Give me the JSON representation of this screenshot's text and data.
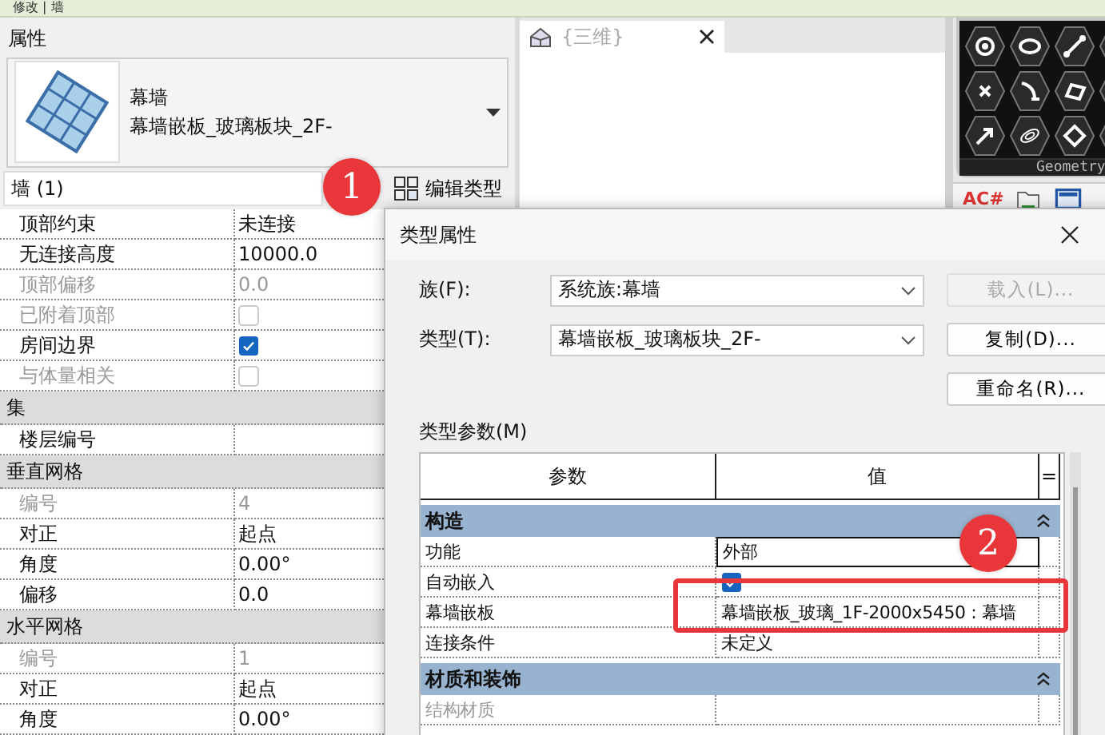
{
  "ribbon_tab": {
    "label": "修改 | 墙"
  },
  "properties": {
    "title": "属性",
    "type_selector": {
      "family": "幕墙",
      "type": "幕墙嵌板_玻璃板块_2F-"
    },
    "instance_filter": "墙 (1)",
    "edit_type_button": "编辑类型",
    "rows": [
      {
        "kind": "text",
        "label": "顶部约束",
        "value": "未连接",
        "disabled": false
      },
      {
        "kind": "text",
        "label": "无连接高度",
        "value": "10000.0",
        "disabled": false
      },
      {
        "kind": "text",
        "label": "顶部偏移",
        "value": "0.0",
        "disabled": true
      },
      {
        "kind": "checkbox",
        "label": "已附着顶部",
        "checked": false,
        "disabled": true
      },
      {
        "kind": "checkbox",
        "label": "房间边界",
        "checked": true,
        "disabled": false
      },
      {
        "kind": "checkbox",
        "label": "与体量相关",
        "checked": false,
        "disabled": true
      },
      {
        "kind": "group",
        "label": "集"
      },
      {
        "kind": "text",
        "label": "楼层编号",
        "disabled": false
      },
      {
        "kind": "group",
        "label": "垂直网格"
      },
      {
        "kind": "text",
        "label": "编号",
        "value": "4",
        "disabled": true
      },
      {
        "kind": "text",
        "label": "对正",
        "value": "起点",
        "disabled": false
      },
      {
        "kind": "text",
        "label": "角度",
        "value": "0.00°",
        "disabled": false
      },
      {
        "kind": "text",
        "label": "偏移",
        "value": "0.0",
        "disabled": false
      },
      {
        "kind": "group",
        "label": "水平网格"
      },
      {
        "kind": "text",
        "label": "编号",
        "value": "1",
        "disabled": true
      },
      {
        "kind": "text",
        "label": "对正",
        "value": "起点",
        "disabled": false
      },
      {
        "kind": "text",
        "label": "角度",
        "value": "0.00°",
        "disabled": false
      }
    ]
  },
  "view_tab": {
    "label": "{三维}"
  },
  "geometry_panel": {
    "title": "Geometry"
  },
  "toolbar": {
    "label": "AC#"
  },
  "dialog": {
    "title": "类型属性",
    "fields": [
      {
        "label": "族(F):",
        "value": "系统族:幕墙"
      },
      {
        "label": "类型(T):",
        "value": "幕墙嵌板_玻璃板块_2F-"
      }
    ],
    "buttons": [
      {
        "label": "载入(L)...",
        "disabled": true
      },
      {
        "label": "复制(D)...",
        "disabled": false
      },
      {
        "label": "重命名(R)...",
        "disabled": false
      }
    ],
    "params_label": "类型参数(M)",
    "table": {
      "columns": [
        "参数",
        "值",
        "="
      ],
      "rows": [
        {
          "kind": "group",
          "label": "构造",
          "expanded": true
        },
        {
          "kind": "text",
          "label": "功能",
          "value": "外部",
          "selected": true,
          "disabled": false
        },
        {
          "kind": "checkbox",
          "label": "自动嵌入",
          "checked": true,
          "selected": false,
          "disabled": false
        },
        {
          "kind": "text",
          "label": "幕墙嵌板",
          "value": "幕墙嵌板_玻璃_1F-2000x5450 : 幕墙",
          "selected": false,
          "disabled": false
        },
        {
          "kind": "text",
          "label": "连接条件",
          "value": "未定义",
          "selected": false,
          "disabled": false
        },
        {
          "kind": "group",
          "label": "材质和装饰",
          "expanded": true
        },
        {
          "kind": "text",
          "label": "结构材质",
          "selected": false,
          "disabled": true
        }
      ]
    }
  },
  "callouts": [
    "1",
    "2"
  ]
}
